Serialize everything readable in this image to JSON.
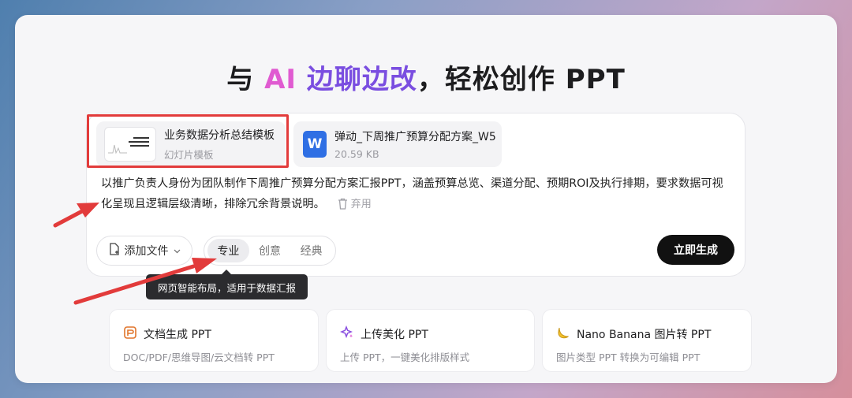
{
  "hero": {
    "prefix": "与 ",
    "ai": "AI",
    "chat": " 边聊边改",
    "suffix": "，轻松创作 PPT"
  },
  "attachments": [
    {
      "name": "业务数据分析总结模板",
      "sub": "幻灯片模板",
      "icon": "slide-thumbnail"
    },
    {
      "name": "弹动_下周推广预算分配方案_W5",
      "sub": "20.59 KB",
      "icon": "word-icon",
      "icon_letter": "W"
    }
  ],
  "prompt": {
    "text": "以推广负责人身份为团队制作下周推广预算分配方案汇报PPT，涵盖预算总览、渠道分配、预期ROI及执行排期，要求数据可视化呈现且逻辑层级清晰，排除冗余背景说明。",
    "discard_label": "弃用"
  },
  "toolbar": {
    "add_file_label": "添加文件",
    "styles": [
      "专业",
      "创意",
      "经典"
    ],
    "active_style": "专业",
    "generate_label": "立即生成"
  },
  "tooltip": "网页智能布局，适用于数据汇报",
  "features": [
    {
      "title": "文档生成 PPT",
      "desc": "DOC/PDF/思维导图/云文档转 PPT",
      "icon": "document-icon"
    },
    {
      "title": "上传美化 PPT",
      "desc": "上传 PPT，一键美化排版样式",
      "icon": "sparkle-icon"
    },
    {
      "title": "Nano Banana 图片转 PPT",
      "desc": "图片类型 PPT 转换为可编辑 PPT",
      "icon": "banana-icon"
    }
  ],
  "colors": {
    "ai_accent": "#e05bd1",
    "chat_accent": "#7a4ee0",
    "highlight_red": "#e23b3b",
    "word_blue": "#2f6fe4"
  }
}
